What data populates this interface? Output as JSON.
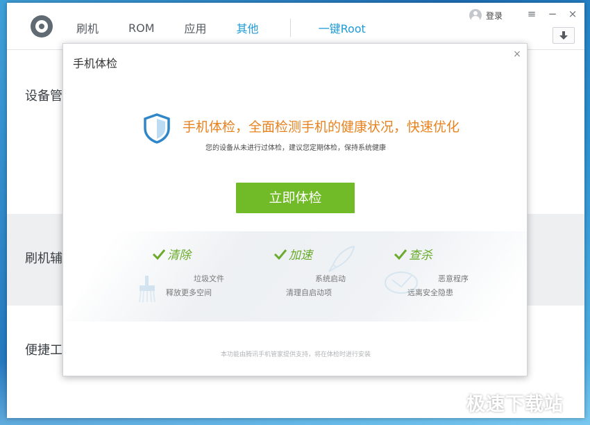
{
  "app": {
    "nav": {
      "tabs": [
        {
          "label": "刷机",
          "active": false
        },
        {
          "label": "ROM",
          "active": false
        },
        {
          "label": "应用",
          "active": false
        },
        {
          "label": "其他",
          "active": true
        }
      ],
      "root_label": "一键Root"
    },
    "login_label": "登录",
    "window_controls": {
      "menu": "≡",
      "minimize": "−",
      "close": "×"
    },
    "sections": [
      {
        "label": "设备管"
      },
      {
        "label": "刷机辅"
      },
      {
        "label": "便捷工"
      }
    ]
  },
  "dialog": {
    "title": "手机体检",
    "close": "×",
    "headline": "手机体检，全面检测手机的健康状况，快速优化",
    "subline": "您的设备从未进行过体检，建议您定期体检，保持系统健康",
    "button_label": "立即体检",
    "features": [
      {
        "name": "清除",
        "line1": "垃圾文件",
        "line2": "释放更多空间",
        "icon": "broom-icon"
      },
      {
        "name": "加速",
        "line1": "系统启动",
        "line2": "清理自启动项",
        "icon": "rocket-icon"
      },
      {
        "name": "查杀",
        "line1": "恶意程序",
        "line2": "远离安全隐患",
        "icon": "shield-scan-icon"
      }
    ],
    "footer_note": "本功能由腾讯手机管家提供支持，将在体检时进行安装"
  },
  "watermark": "极速下载站",
  "colors": {
    "accent_blue": "#1e9bd6",
    "accent_orange": "#e8821e",
    "accent_green": "#72bb28",
    "feature_green": "#6aab2b"
  }
}
